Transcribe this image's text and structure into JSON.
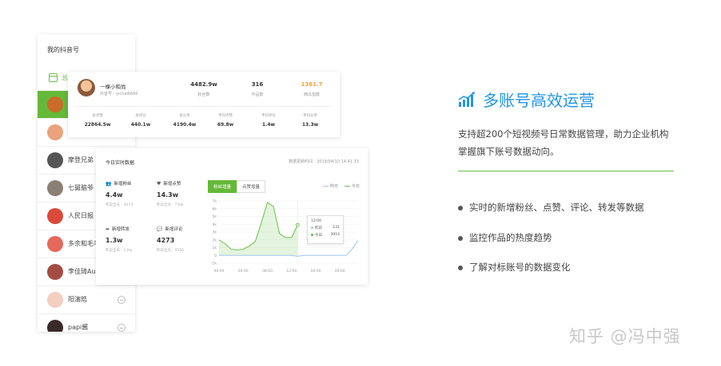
{
  "sidebar": {
    "title": "我的抖音号",
    "overview_tab": "总",
    "accounts": [
      {
        "name": "",
        "avatar_color": "#c96b2b",
        "active": true,
        "has_action": false
      },
      {
        "name": "",
        "avatar_color": "#e9a27a",
        "active": false,
        "has_action": false
      },
      {
        "name": "摩登兄弟",
        "avatar_color": "#555555",
        "active": false,
        "has_action": false
      },
      {
        "name": "七舅脑爷",
        "avatar_color": "#8a7f74",
        "active": false,
        "has_action": false
      },
      {
        "name": "人民日报",
        "avatar_color": "#d94a3a",
        "active": false,
        "has_action": false
      },
      {
        "name": "多余和毛毛",
        "avatar_color": "#e4695a",
        "active": false,
        "has_action": false
      },
      {
        "name": "李佳琦Aus",
        "avatar_color": "#a34c43",
        "active": false,
        "has_action": false
      },
      {
        "name": "阳演皓",
        "avatar_color": "#f2cfc1",
        "active": false,
        "has_action": true
      },
      {
        "name": "papi酱",
        "avatar_color": "#3a2a28",
        "active": false,
        "has_action": true
      }
    ]
  },
  "account_card": {
    "name": "一棵小和尚",
    "id_line": "抖音号：yichai6666",
    "stats": [
      {
        "value": "4482.9w",
        "label": "粉丝数",
        "highlight": false
      },
      {
        "value": "316",
        "label": "作品数",
        "highlight": false
      },
      {
        "value": "1361.7",
        "label": "西瓜指数",
        "highlight": true
      }
    ],
    "metrics": [
      {
        "label": "总点赞",
        "value": "22864.5w"
      },
      {
        "label": "总评论",
        "value": "440.1w"
      },
      {
        "label": "总分享",
        "value": "4190.4w"
      },
      {
        "label": "平均点赞",
        "value": "69.8w"
      },
      {
        "label": "平均评论",
        "value": "1.4w"
      },
      {
        "label": "平均分享",
        "value": "13.3w"
      }
    ]
  },
  "realtime": {
    "title": "今日实时数据",
    "updated": "数据更新时间：2019/04/10 14:41:33",
    "kpis": [
      {
        "icon": "👥",
        "icon_name": "users-icon",
        "label": "新增粉丝",
        "value": "4.4w",
        "sub": "昨日全天：3673"
      },
      {
        "icon": "♥",
        "icon_name": "heart-icon",
        "label": "新增点赞",
        "value": "14.3w",
        "sub": "昨日全天：7.0w"
      },
      {
        "icon": "➦",
        "icon_name": "share-icon",
        "label": "新增转发",
        "value": "1.3w",
        "sub": "昨日全天：1.0w"
      },
      {
        "icon": "💬",
        "icon_name": "comment-icon",
        "label": "新增评论",
        "value": "4273",
        "sub": "昨日全天：3556"
      }
    ],
    "tabs": [
      {
        "label": "粉丝增量",
        "active": true
      },
      {
        "label": "点赞增量",
        "active": false
      }
    ],
    "tooltip": {
      "time": "13:00",
      "rows": [
        {
          "label": "昨日",
          "value": "-131",
          "color": "#9fc7f0"
        },
        {
          "label": "今日",
          "value": "3914",
          "color": "#65b838"
        }
      ]
    }
  },
  "chart_data": {
    "type": "area",
    "x": [
      "00:00",
      "01:00",
      "02:00",
      "03:00",
      "04:00",
      "05:00",
      "06:00",
      "07:00",
      "08:00",
      "09:00",
      "10:00",
      "11:00",
      "12:00",
      "13:00",
      "14:00",
      "15:00",
      "16:00",
      "17:00",
      "18:00",
      "19:00",
      "20:00",
      "21:00",
      "22:00",
      "23:00"
    ],
    "x_ticks": [
      "00:00",
      "04:00",
      "08:00",
      "12:00",
      "16:00",
      "20:00"
    ],
    "y_ticks": [
      "7k",
      "6k",
      "5k",
      "4k",
      "3k",
      "2k",
      "1k",
      "0",
      "-1k"
    ],
    "ylim": [
      -1000,
      7000
    ],
    "series": [
      {
        "name": "今日",
        "color": "#6cc04a",
        "values": [
          2000,
          1500,
          800,
          700,
          800,
          1200,
          1800,
          4200,
          6800,
          6300,
          2800,
          2300,
          2300,
          3914,
          null,
          null,
          null,
          null,
          null,
          null,
          null,
          null,
          null,
          null
        ]
      },
      {
        "name": "昨日",
        "color": "#9fc7f0",
        "values": [
          0,
          0,
          0,
          0,
          0,
          0,
          0,
          0,
          0,
          0,
          0,
          0,
          0,
          -131,
          0,
          0,
          0,
          0,
          0,
          0,
          0,
          0,
          800,
          1900
        ]
      }
    ],
    "legend": "top-right",
    "grid": true
  },
  "feature": {
    "title": "多账号高效运营",
    "description": "支持超200个短视频号日常数据管理，助力企业机构掌握旗下账号数据动向。",
    "bullets": [
      "实时的新增粉丝、点赞、评论、转发等数据",
      "监控作品的热度趋势",
      "了解对标账号的数据变化"
    ]
  },
  "watermark": "知乎 @冯中强"
}
